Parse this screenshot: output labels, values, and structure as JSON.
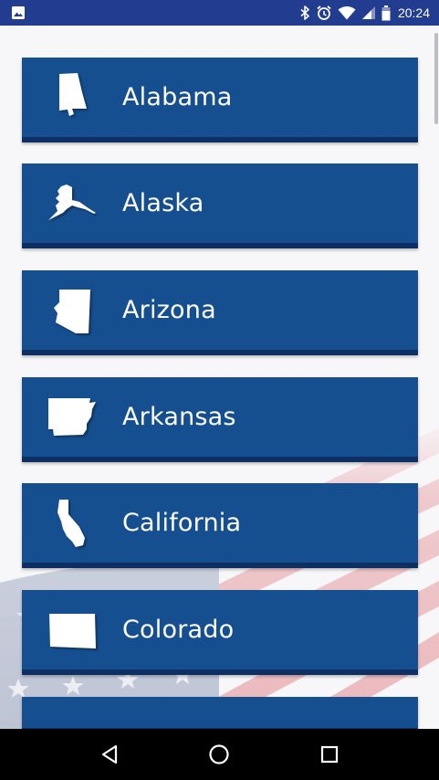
{
  "status_bar": {
    "time": "20:24",
    "icons": [
      "image-notification-icon",
      "bluetooth-icon",
      "alarm-icon",
      "wifi-icon",
      "cell-signal-icon",
      "battery-icon"
    ]
  },
  "states": [
    {
      "name": "Alabama",
      "icon": "alabama-map-icon"
    },
    {
      "name": "Alaska",
      "icon": "alaska-map-icon"
    },
    {
      "name": "Arizona",
      "icon": "arizona-map-icon"
    },
    {
      "name": "Arkansas",
      "icon": "arkansas-map-icon"
    },
    {
      "name": "California",
      "icon": "california-map-icon"
    },
    {
      "name": "Colorado",
      "icon": "colorado-map-icon"
    }
  ],
  "colors": {
    "status_bar": "#223d8f",
    "card": "#164f8f",
    "card_shadow": "#0d2f63",
    "background": "#f7f7f9"
  },
  "nav_bar": {
    "buttons": [
      "back-icon",
      "home-icon",
      "recents-icon"
    ]
  }
}
